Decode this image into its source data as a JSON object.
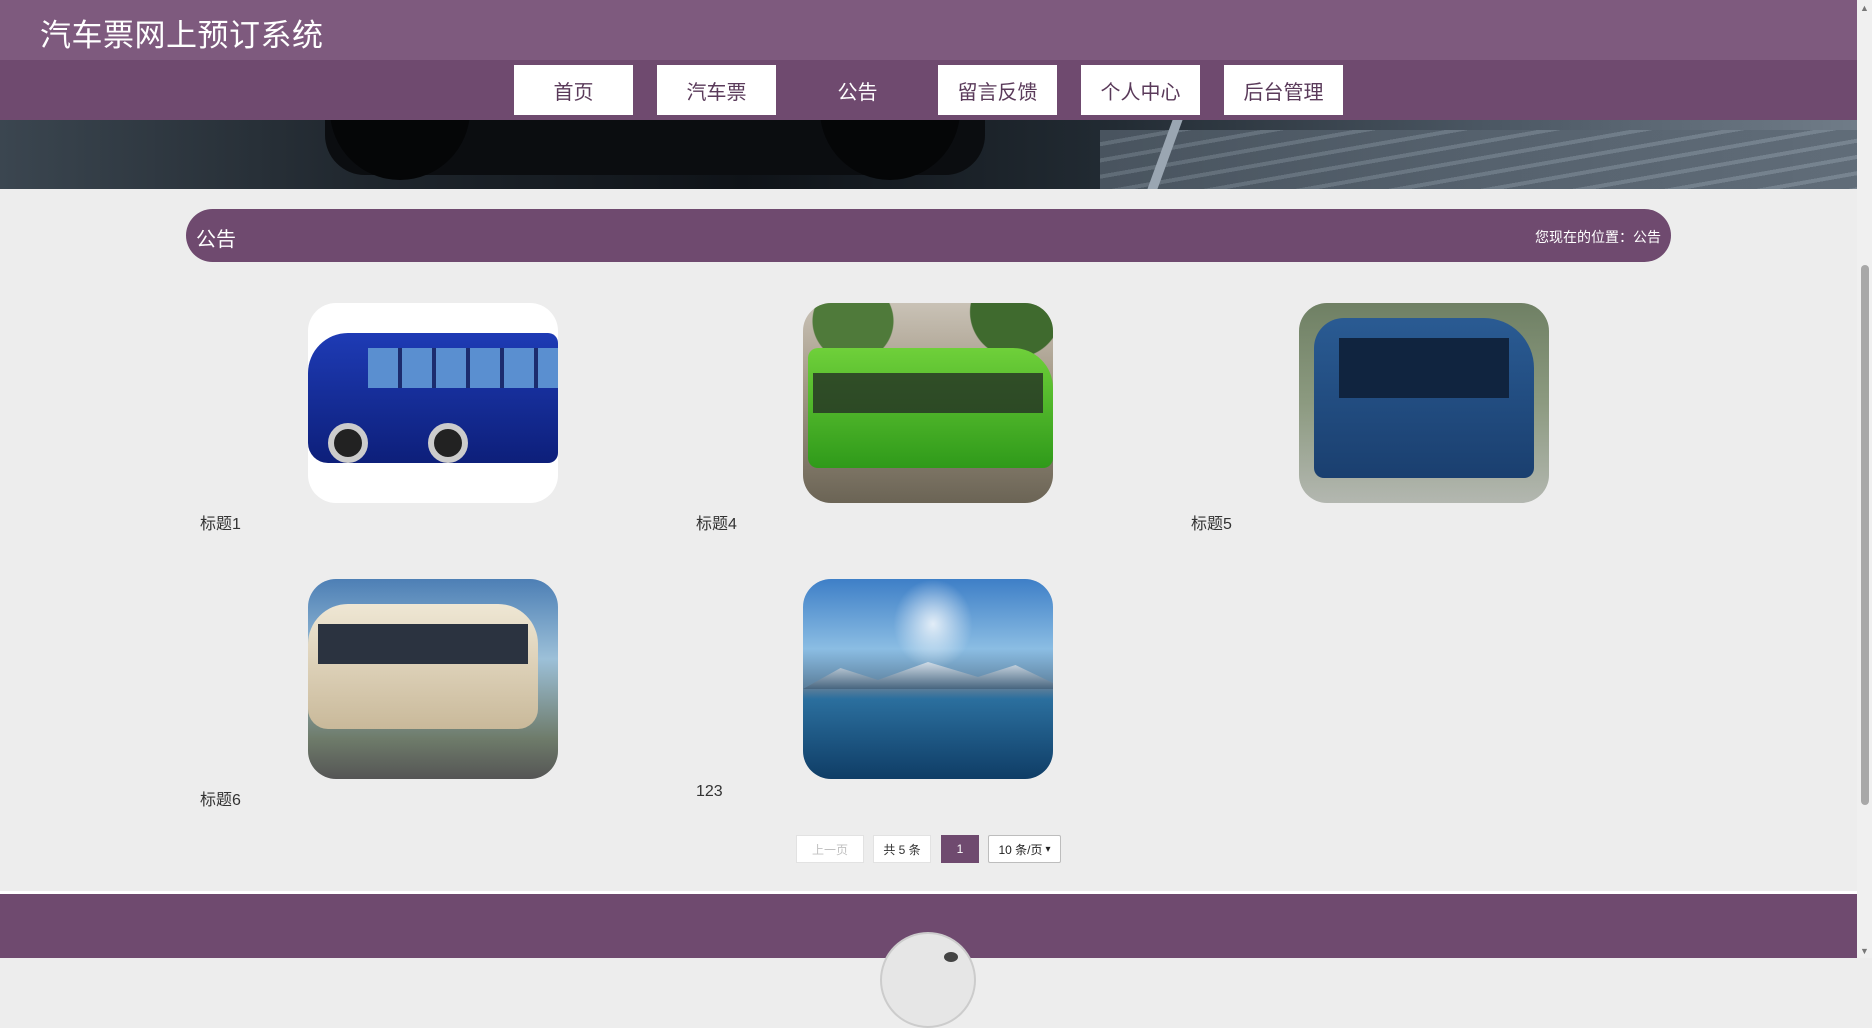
{
  "site": {
    "title": "汽车票网上预订系统"
  },
  "nav": {
    "items": [
      {
        "label": "首页"
      },
      {
        "label": "汽车票"
      },
      {
        "label": "公告"
      },
      {
        "label": "留言反馈"
      },
      {
        "label": "个人中心"
      },
      {
        "label": "后台管理"
      }
    ],
    "active": "公告"
  },
  "section": {
    "title": "公告",
    "breadcrumb": "您现在的位置：公告"
  },
  "cards": [
    {
      "title": "标题1",
      "image": "blue-coach-bus"
    },
    {
      "title": "标题4",
      "image": "green-bus-with-palm-trees"
    },
    {
      "title": "标题5",
      "image": "blue-bus-mountains"
    },
    {
      "title": "标题6",
      "image": "white-minibus-mountains"
    },
    {
      "title": "123",
      "image": "lake-and-mountains"
    }
  ],
  "pagination": {
    "prev": "上一页",
    "total": "共 5 条",
    "current": "1",
    "page_size": "10 条/页"
  },
  "colors": {
    "primary": "#6f4a6f",
    "topbar": "#7e5a7e",
    "background": "#ededed"
  }
}
